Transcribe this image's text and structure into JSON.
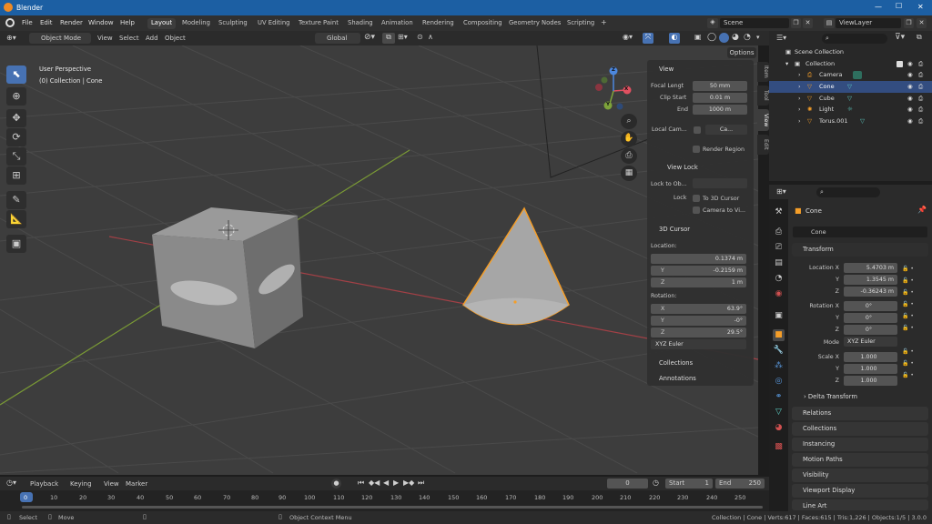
{
  "window": {
    "title": "Blender",
    "controls": [
      "—",
      "☐",
      "✕"
    ]
  },
  "menu": [
    "File",
    "Edit",
    "Render",
    "Window",
    "Help"
  ],
  "workspaces": [
    "Layout",
    "Modeling",
    "Sculpting",
    "UV Editing",
    "Texture Paint",
    "Shading",
    "Animation",
    "Rendering",
    "Compositing",
    "Geometry Nodes",
    "Scripting"
  ],
  "add_workspace": "+",
  "scene": {
    "name": "Scene",
    "view_layer": "ViewLayer"
  },
  "viewport_header": {
    "mode": "Object Mode",
    "menus": [
      "View",
      "Select",
      "Add",
      "Object"
    ],
    "orientation": "Global",
    "options": "Options"
  },
  "viewport": {
    "perspective": "User Perspective",
    "context": "(0) Collection | Cone"
  },
  "gizmo": {
    "x": "X",
    "y": "Y",
    "z": "Z"
  },
  "npanel": {
    "tabs": [
      "Item",
      "Tool",
      "View",
      "Edit"
    ],
    "view_header": "View",
    "focal_length_label": "Focal Lengt",
    "focal_length": "50 mm",
    "clip_start_label": "Clip Start",
    "clip_start": "0.01 m",
    "end_label": "End",
    "clip_end": "1000 m",
    "local_camera_label": "Local Cam...",
    "local_camera_value": "Ca...",
    "render_region": "Render Region",
    "view_lock_header": "View Lock",
    "lock_to_object_label": "Lock to Ob...",
    "lock_label": "Lock",
    "to_3d_cursor": "To 3D Cursor",
    "camera_to_view": "Camera to Vi...",
    "cursor_header": "3D Cursor",
    "location_label": "Location:",
    "loc_x_label": "X",
    "loc_x": "0.1374 m",
    "loc_y_label": "Y",
    "loc_y": "-0.2159 m",
    "loc_z_label": "Z",
    "loc_z": "1 m",
    "rotation_label": "Rotation:",
    "rot_x_label": "X",
    "rot_x": "63.9°",
    "rot_y_label": "Y",
    "rot_y": "-0°",
    "rot_z_label": "Z",
    "rot_z": "29.5°",
    "rotation_mode": "XYZ Euler",
    "collections": "Collections",
    "annotations": "Annotations"
  },
  "outliner": {
    "root": "Scene Collection",
    "collection": "Collection",
    "items": [
      "Camera",
      "Cone",
      "Cube",
      "Light",
      "Torus.001"
    ]
  },
  "properties": {
    "object_name": "Cone",
    "object_field": "Cone",
    "transform": "Transform",
    "location_x_label": "Location X",
    "location_x": "5.4703 m",
    "location_y_label": "Y",
    "location_y": "1.3545 m",
    "location_z_label": "Z",
    "location_z": "-0.36243 m",
    "rotation_x_label": "Rotation X",
    "rotation_x": "0°",
    "rotation_y_label": "Y",
    "rotation_y": "0°",
    "rotation_z_label": "Z",
    "rotation_z": "0°",
    "mode_label": "Mode",
    "mode": "XYZ Euler",
    "scale_x_label": "Scale X",
    "scale_x": "1.000",
    "scale_y_label": "Y",
    "scale_y": "1.000",
    "scale_z_label": "Z",
    "scale_z": "1.000",
    "delta_transform": "Delta Transform",
    "sections": [
      "Relations",
      "Collections",
      "Instancing",
      "Motion Paths",
      "Visibility",
      "Viewport Display",
      "Line Art"
    ]
  },
  "timeline": {
    "menus": [
      "Playback",
      "Keying",
      "View",
      "Marker"
    ],
    "current_frame": "0",
    "start_label": "Start",
    "start": "1",
    "end_label": "End",
    "end": "250",
    "ticks": [
      "0",
      "10",
      "20",
      "30",
      "40",
      "50",
      "60",
      "70",
      "80",
      "90",
      "100",
      "110",
      "120",
      "130",
      "140",
      "150",
      "160",
      "170",
      "180",
      "190",
      "200",
      "210",
      "220",
      "230",
      "240",
      "250"
    ]
  },
  "status": {
    "select": "Select",
    "move": "Move",
    "context_menu": "Object Context Menu",
    "stats": "Collection | Cone | Verts:617 | Faces:615 | Tris:1,226 | Objects:1/5 | 3.0.0"
  },
  "colors": {
    "accent": "#4772b3",
    "selection": "#f59e28",
    "title_bar": "#1c5fa3"
  }
}
